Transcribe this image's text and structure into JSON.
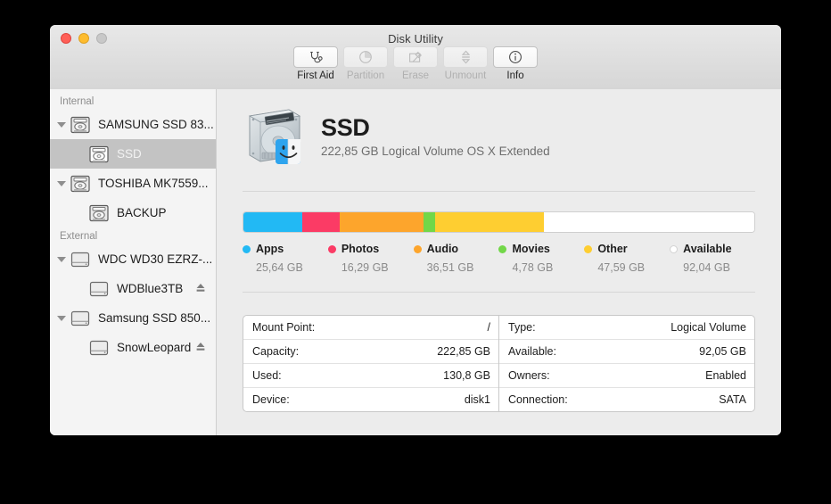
{
  "window": {
    "title": "Disk Utility",
    "controls": [
      {
        "name": "close",
        "label": "Close"
      },
      {
        "name": "minimize",
        "label": "Minimize"
      },
      {
        "name": "zoom",
        "label": "Zoom"
      }
    ]
  },
  "toolbar": {
    "items": [
      {
        "label": "First Aid",
        "icon": "stethoscope-icon",
        "enabled": true
      },
      {
        "label": "Partition",
        "icon": "pie-chart-icon",
        "enabled": false
      },
      {
        "label": "Erase",
        "icon": "erase-icon",
        "enabled": false
      },
      {
        "label": "Unmount",
        "icon": "unmount-icon",
        "enabled": false
      },
      {
        "label": "Info",
        "icon": "info-icon",
        "enabled": true
      }
    ]
  },
  "sidebar": {
    "sections": [
      {
        "header": "Internal",
        "items": [
          {
            "label": "SAMSUNG SSD 83...",
            "icon": "internal-drive-icon",
            "level": "parent",
            "expanded": true,
            "selected": false,
            "eject": false
          },
          {
            "label": "SSD",
            "icon": "volume-icon",
            "level": "child",
            "expanded": false,
            "selected": true,
            "eject": false
          },
          {
            "label": "TOSHIBA MK7559...",
            "icon": "internal-drive-icon",
            "level": "parent",
            "expanded": true,
            "selected": false,
            "eject": false
          },
          {
            "label": "BACKUP",
            "icon": "volume-icon",
            "level": "child",
            "expanded": false,
            "selected": false,
            "eject": false
          }
        ]
      },
      {
        "header": "External",
        "items": [
          {
            "label": "WDC WD30 EZRZ-...",
            "icon": "external-drive-icon",
            "level": "parent",
            "expanded": true,
            "selected": false,
            "eject": false
          },
          {
            "label": "WDBlue3TB",
            "icon": "external-drive-icon",
            "level": "child",
            "expanded": false,
            "selected": false,
            "eject": true
          },
          {
            "label": "Samsung SSD 850...",
            "icon": "external-drive-icon",
            "level": "parent",
            "expanded": true,
            "selected": false,
            "eject": false
          },
          {
            "label": "SnowLeopard",
            "icon": "external-drive-icon",
            "level": "child",
            "expanded": false,
            "selected": false,
            "eject": true
          }
        ]
      }
    ]
  },
  "main": {
    "disk": {
      "name": "SSD",
      "subtitle": "222,85 GB Logical Volume OS X Extended",
      "icon": "hard-disk-icon",
      "badge": "finder-badge-icon"
    },
    "usage": {
      "total_label": "222,85 GB",
      "segments": [
        {
          "name": "Apps",
          "value": "25,64 GB",
          "color": "#22b9f4",
          "percent": 11.6
        },
        {
          "name": "Photos",
          "value": "16,29 GB",
          "color": "#fb3b65",
          "percent": 7.3
        },
        {
          "name": "Audio",
          "value": "36,51 GB",
          "color": "#fda52c",
          "percent": 16.4
        },
        {
          "name": "Movies",
          "value": "4,78 GB",
          "color": "#72d748",
          "percent": 2.2
        },
        {
          "name": "Other",
          "value": "47,59 GB",
          "color": "#fece31",
          "percent": 21.4
        },
        {
          "name": "Available",
          "value": "92,04 GB",
          "color": "#ffffff",
          "percent": 41.1
        }
      ]
    },
    "info": {
      "left": [
        {
          "key": "Mount Point:",
          "value": "/"
        },
        {
          "key": "Capacity:",
          "value": "222,85 GB"
        },
        {
          "key": "Used:",
          "value": "130,8 GB"
        },
        {
          "key": "Device:",
          "value": "disk1"
        }
      ],
      "right": [
        {
          "key": "Type:",
          "value": "Logical Volume"
        },
        {
          "key": "Available:",
          "value": "92,05 GB"
        },
        {
          "key": "Owners:",
          "value": "Enabled"
        },
        {
          "key": "Connection:",
          "value": "SATA"
        }
      ]
    }
  }
}
